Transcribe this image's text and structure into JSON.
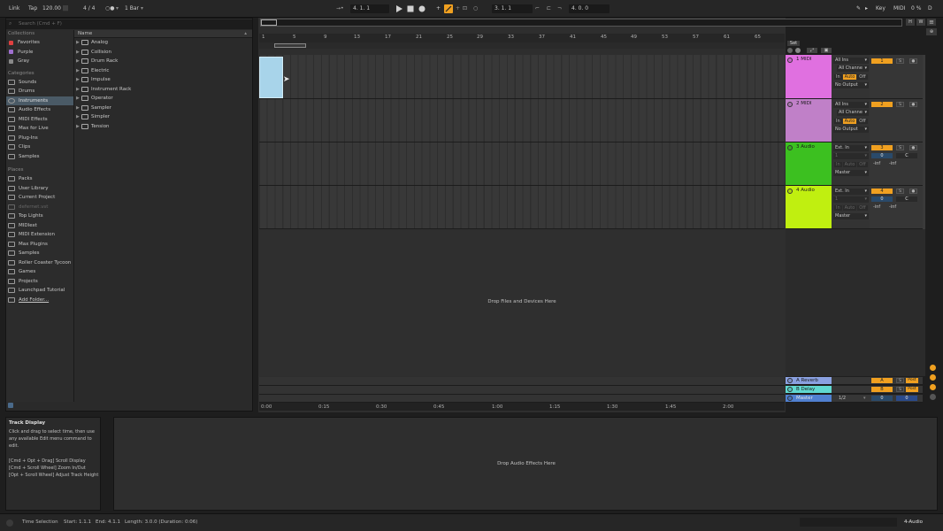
{
  "topbar": {
    "link": "Link",
    "tap": "Tap",
    "tempo": "120.00",
    "time_sig": "4 / 4",
    "quantize": "1 Bar",
    "arrangement_position": "4.   1.   1",
    "loop_start": "3.   1.   1",
    "loop_length": "4.   0.   0",
    "key": "Key",
    "midi": "MIDI",
    "cpu": "0 %",
    "d": "D"
  },
  "browser": {
    "search_placeholder": "Search (Cmd + F)",
    "collections_header": "Collections",
    "collections": [
      {
        "label": "Favorites",
        "color": "#e04040"
      },
      {
        "label": "Purple",
        "color": "#a070d0"
      },
      {
        "label": "Gray",
        "color": "#8a8a8a"
      }
    ],
    "categories_header": "Categories",
    "categories": [
      "Sounds",
      "Drums",
      "Instruments",
      "Audio Effects",
      "MIDI Effects",
      "Max for Live",
      "Plug-Ins",
      "Clips",
      "Samples"
    ],
    "selected_category": "Instruments",
    "places_header": "Places",
    "places": [
      "Packs",
      "User Library",
      "Current Project",
      "defernet.vst",
      "Top Lights",
      "MIDIext",
      "MIDI Extension",
      "Max Plugins",
      "Samples",
      "Roller Coaster Tycoon",
      "Games",
      "Projects",
      "Launchpad Tutorial",
      "Add Folder..."
    ],
    "name_header": "Name",
    "items": [
      "Analog",
      "Collision",
      "Drum Rack",
      "Electric",
      "Impulse",
      "Instrument Rack",
      "Operator",
      "Sampler",
      "Simpler",
      "Tension"
    ]
  },
  "ruler": {
    "bars": [
      "1",
      "5",
      "9",
      "13",
      "17",
      "21",
      "25",
      "29",
      "33",
      "37",
      "41",
      "45",
      "49",
      "53",
      "57",
      "61",
      "65"
    ]
  },
  "timebar": {
    "times": [
      "0:00",
      "0:15",
      "0:30",
      "0:45",
      "1:00",
      "1:15",
      "1:30",
      "1:45",
      "2:00"
    ]
  },
  "drop_files": "Drop Files and Devices Here",
  "drop_effects": "Drop Audio Effects Here",
  "set_label": "Set",
  "tracks": [
    {
      "name": "1 MIDI",
      "color": "#e070e0",
      "input": "All Ins",
      "channel": "All Channe",
      "monitor_in": "In",
      "monitor_auto": "Auto",
      "monitor_off": "Off",
      "output": "No Output",
      "number": "1",
      "solo": "S",
      "type": "midi"
    },
    {
      "name": "2 MIDI",
      "color": "#c080c8",
      "input": "All Ins",
      "channel": "All Channe",
      "monitor_in": "In",
      "monitor_auto": "Auto",
      "monitor_off": "Off",
      "output": "No Output",
      "number": "2",
      "solo": "S",
      "type": "midi"
    },
    {
      "name": "3 Audio",
      "color": "#3cc020",
      "input": "Ext. In",
      "channel": "1",
      "monitor_in": "In",
      "monitor_auto": "Auto",
      "monitor_off": "Off",
      "output": "Master",
      "number": "3",
      "solo": "S",
      "vol": "0",
      "pan": "C",
      "peak_l": "-inf",
      "peak_r": "-inf",
      "type": "audio"
    },
    {
      "name": "4 Audio",
      "color": "#c0ef10",
      "input": "Ext. In",
      "channel": "1",
      "monitor_in": "In",
      "monitor_auto": "Auto",
      "monitor_off": "Off",
      "output": "Master",
      "number": "4",
      "solo": "S",
      "vol": "0",
      "pan": "C",
      "peak_l": "-inf",
      "peak_r": "-inf",
      "type": "audio"
    }
  ],
  "returns": [
    {
      "name": "A Reverb",
      "color": "#8aa0e0",
      "letter": "A",
      "solo": "S",
      "post": "Post"
    },
    {
      "name": "B Delay",
      "color": "#60d8d0",
      "letter": "B",
      "solo": "S",
      "post": "Post"
    }
  ],
  "master": {
    "name": "Master",
    "color": "#5080d0",
    "cue": "1/2",
    "vol": "0",
    "pan": "0"
  },
  "info_view": {
    "title": "Track Display",
    "body": "Click and drag to select time, then use any available Edit menu command to edit.",
    "shortcuts": [
      "[Cmd + Opt + Drag] Scroll Display",
      "[Cmd + Scroll Wheel] Zoom In/Out",
      "[Opt + Scroll Wheel] Adjust Track Height"
    ]
  },
  "status": {
    "selection": "Time Selection",
    "start": "Start: 1.1.1",
    "end": "End: 4.1.1",
    "length": "Length: 3.0.0  (Duration: 0:06)",
    "track": "4-Audio"
  }
}
